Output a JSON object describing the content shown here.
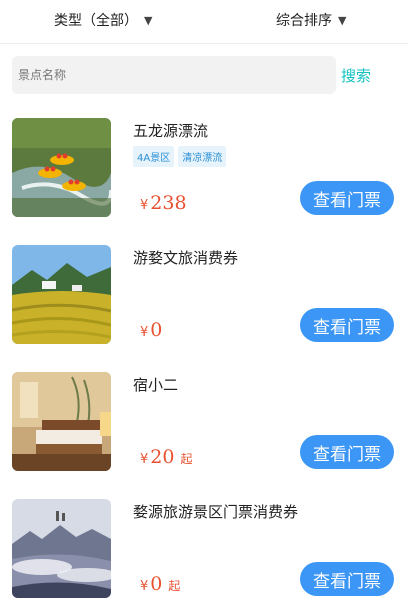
{
  "filters": {
    "type_label": "类型（全部）",
    "sort_label": "综合排序"
  },
  "search": {
    "placeholder": "景点名称",
    "button_label": "搜索"
  },
  "items": [
    {
      "title": "五龙源漂流",
      "tags": [
        "4A景区",
        "清凉漂流"
      ],
      "currency": "¥",
      "price": "238",
      "suffix": ""
    },
    {
      "title": "游婺文旅消费券",
      "tags": [],
      "currency": "¥",
      "price": "0",
      "suffix": ""
    },
    {
      "title": "宿小二",
      "tags": [],
      "currency": "¥",
      "price": "20",
      "suffix": "起"
    },
    {
      "title": "婺源旅游景区门票消费券",
      "tags": [],
      "currency": "¥",
      "price": "0",
      "suffix": "起"
    }
  ],
  "ticket_button_label": "查看门票",
  "colors": {
    "accent_search": "#14c2c2",
    "button_blue": "#3b96f5",
    "price_red": "#e8502f",
    "tag_blue": "#2a8fd6"
  }
}
